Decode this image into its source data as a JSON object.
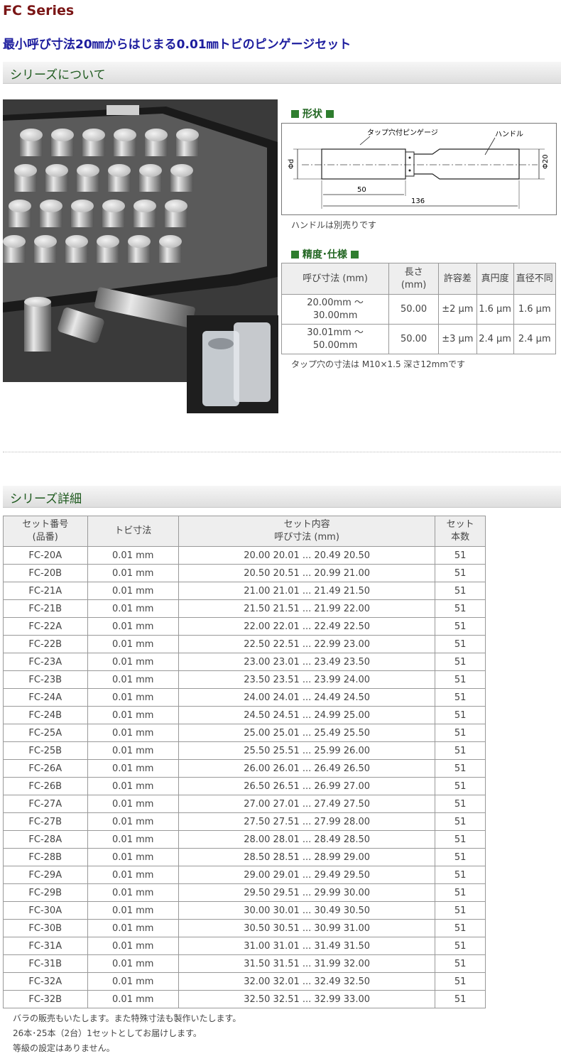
{
  "page": {
    "title": "FC Series",
    "subtitle": "最小呼び寸法20㎜からはじまる0.01㎜トビのピンゲージセット"
  },
  "about": {
    "heading": "シリーズについて"
  },
  "shape": {
    "heading": "形状",
    "labels": {
      "gauge": "タップ穴付ピンゲージ",
      "handle": "ハンドル",
      "phi_d": "Φd",
      "phi_20": "Φ20",
      "len_50": "50",
      "len_136": "136"
    },
    "note": "ハンドルは別売りです"
  },
  "accuracy": {
    "heading": "精度･仕様",
    "headers": [
      "呼び寸法 (mm)",
      "長さ\n(mm)",
      "許容差",
      "真円度",
      "直径不同"
    ],
    "rows": [
      [
        "20.00mm ～ 30.00mm",
        "50.00",
        "±2 μm",
        "1.6 μm",
        "1.6 μm"
      ],
      [
        "30.01mm ～ 50.00mm",
        "50.00",
        "±3 μm",
        "2.4 μm",
        "2.4 μm"
      ]
    ],
    "note": "タップ穴の寸法は M10×1.5  深さ12mmです"
  },
  "details": {
    "heading": "シリーズ詳細",
    "headers": [
      "セット番号\n(品番)",
      "トビ寸法",
      "セット内容\n呼び寸法 (mm)",
      "セット\n本数"
    ],
    "rows": [
      [
        "FC-20A",
        "0.01 mm",
        "20.00 20.01 ... 20.49 20.50",
        "51"
      ],
      [
        "FC-20B",
        "0.01 mm",
        "20.50 20.51 ... 20.99 21.00",
        "51"
      ],
      [
        "FC-21A",
        "0.01 mm",
        "21.00 21.01 ... 21.49 21.50",
        "51"
      ],
      [
        "FC-21B",
        "0.01 mm",
        "21.50 21.51 ... 21.99 22.00",
        "51"
      ],
      [
        "FC-22A",
        "0.01 mm",
        "22.00 22.01 ... 22.49 22.50",
        "51"
      ],
      [
        "FC-22B",
        "0.01 mm",
        "22.50 22.51 ... 22.99 23.00",
        "51"
      ],
      [
        "FC-23A",
        "0.01 mm",
        "23.00 23.01 ... 23.49 23.50",
        "51"
      ],
      [
        "FC-23B",
        "0.01 mm",
        "23.50 23.51 ... 23.99 24.00",
        "51"
      ],
      [
        "FC-24A",
        "0.01 mm",
        "24.00 24.01 ... 24.49 24.50",
        "51"
      ],
      [
        "FC-24B",
        "0.01 mm",
        "24.50 24.51 ... 24.99 25.00",
        "51"
      ],
      [
        "FC-25A",
        "0.01 mm",
        "25.00 25.01 ... 25.49 25.50",
        "51"
      ],
      [
        "FC-25B",
        "0.01 mm",
        "25.50 25.51 ... 25.99 26.00",
        "51"
      ],
      [
        "FC-26A",
        "0.01 mm",
        "26.00 26.01 ... 26.49 26.50",
        "51"
      ],
      [
        "FC-26B",
        "0.01 mm",
        "26.50 26.51 ... 26.99 27.00",
        "51"
      ],
      [
        "FC-27A",
        "0.01 mm",
        "27.00 27.01 ... 27.49 27.50",
        "51"
      ],
      [
        "FC-27B",
        "0.01 mm",
        "27.50 27.51 ... 27.99 28.00",
        "51"
      ],
      [
        "FC-28A",
        "0.01 mm",
        "28.00 28.01 ... 28.49 28.50",
        "51"
      ],
      [
        "FC-28B",
        "0.01 mm",
        "28.50 28.51 ... 28.99 29.00",
        "51"
      ],
      [
        "FC-29A",
        "0.01 mm",
        "29.00 29.01 ... 29.49 29.50",
        "51"
      ],
      [
        "FC-29B",
        "0.01 mm",
        "29.50 29.51 ... 29.99 30.00",
        "51"
      ],
      [
        "FC-30A",
        "0.01 mm",
        "30.00 30.01 ... 30.49 30.50",
        "51"
      ],
      [
        "FC-30B",
        "0.01 mm",
        "30.50 30.51 ... 30.99 31.00",
        "51"
      ],
      [
        "FC-31A",
        "0.01 mm",
        "31.00 31.01 ... 31.49 31.50",
        "51"
      ],
      [
        "FC-31B",
        "0.01 mm",
        "31.50 31.51 ... 31.99 32.00",
        "51"
      ],
      [
        "FC-32A",
        "0.01 mm",
        "32.00 32.01 ... 32.49 32.50",
        "51"
      ],
      [
        "FC-32B",
        "0.01 mm",
        "32.50 32.51 ... 32.99 33.00",
        "51"
      ]
    ],
    "notes": [
      "バラの販売もいたします。また特殊寸法も製作いたします。",
      "26本･25本（2台）1セットとしてお届けします。",
      "等級の設定はありません。"
    ]
  },
  "colors": {
    "title": "#7a1515",
    "subtitle": "#1d1d9e",
    "section_heading": "#1f5a1f",
    "spec_square": "#2e7d2e"
  }
}
